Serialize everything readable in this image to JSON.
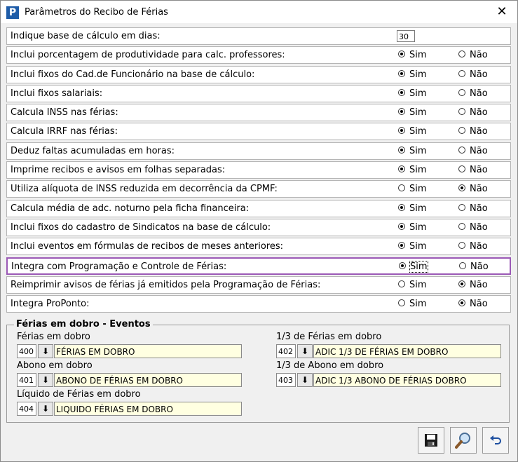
{
  "window": {
    "title": "Parâmetros do Recibo de Férias",
    "close_glyph": "✕",
    "app_icon_letter": "P"
  },
  "params": {
    "days_label": "Indique base de cálculo em dias:",
    "days_value": "30",
    "sim_label": "Sim",
    "nao_label": "Não",
    "rows": [
      {
        "label": "Inclui porcentagem de produtividade para calc. professores:",
        "selected": "Sim"
      },
      {
        "label": "Inclui fixos do Cad.de Funcionário na base de cálculo:",
        "selected": "Sim"
      },
      {
        "label": "Inclui fixos salariais:",
        "selected": "Sim"
      },
      {
        "label": "Calcula INSS nas férias:",
        "selected": "Sim"
      },
      {
        "label": "Calcula IRRF nas férias:",
        "selected": "Sim"
      },
      {
        "label": "Deduz faltas acumuladas em horas:",
        "selected": "Sim"
      },
      {
        "label": "Imprime recibos e avisos em folhas separadas:",
        "selected": "Sim"
      },
      {
        "label": "Utiliza alíquota de INSS reduzida em decorrência da CPMF:",
        "selected": "Não"
      },
      {
        "label": "Calcula média de adc. noturno pela ficha financeira:",
        "selected": "Sim"
      },
      {
        "label": "Inclui fixos do cadastro de Sindicatos na base de cálculo:",
        "selected": "Sim"
      },
      {
        "label": "Inclui eventos em fórmulas de recibos de meses anteriores:",
        "selected": "Sim"
      },
      {
        "label": "Integra com Programação e Controle de Férias:",
        "selected": "Sim"
      },
      {
        "label": "Reimprimir avisos de férias já emitidos pela Programação de Férias:",
        "selected": "Não"
      },
      {
        "label": "Integra ProPonto:",
        "selected": "Não"
      }
    ]
  },
  "events": {
    "title": "Férias em dobro - Eventos",
    "fields": [
      {
        "label": "Férias em dobro",
        "code": "400",
        "desc": "FÉRIAS EM DOBRO"
      },
      {
        "label": "1/3 de Férias em dobro",
        "code": "402",
        "desc": "ADIC 1/3 DE FÉRIAS EM DOBRO"
      },
      {
        "label": "Abono em dobro",
        "code": "401",
        "desc": "ABONO DE FÉRIAS EM DOBRO"
      },
      {
        "label": "1/3 de Abono em dobro",
        "code": "403",
        "desc": "ADIC 1/3 ABONO DE FÉRIAS DOBRO"
      },
      {
        "label": "Líquido de Férias em dobro",
        "code": "404",
        "desc": "LIQUIDO FÉRIAS EM DOBRO"
      }
    ],
    "lookup_glyph": "⬇"
  },
  "icons": {
    "save": "save-icon",
    "search": "magnifier-icon",
    "undo": "undo-icon"
  },
  "colors": {
    "highlight_border": "#9b59b6",
    "desc_background": "#ffffe1",
    "app_icon": "#1e5ca8"
  }
}
